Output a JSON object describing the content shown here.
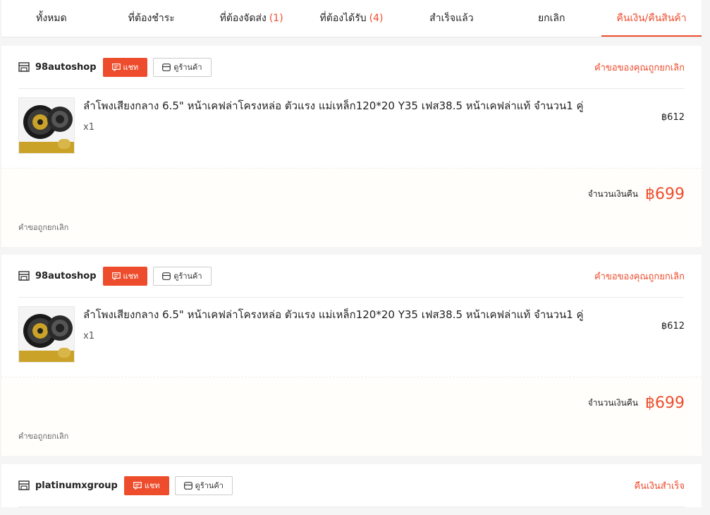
{
  "tabs": [
    {
      "label": "ทั้งหมด",
      "count": ""
    },
    {
      "label": "ที่ต้องชำระ",
      "count": ""
    },
    {
      "label": "ที่ต้องจัดส่ง",
      "count": "(1)"
    },
    {
      "label": "ที่ต้องได้รับ",
      "count": "(4)"
    },
    {
      "label": "สำเร็จแล้ว",
      "count": ""
    },
    {
      "label": "ยกเลิก",
      "count": ""
    },
    {
      "label": "คืนเงิน/คืนสินค้า",
      "count": ""
    }
  ],
  "active_tab": "คืนเงิน/คืนสินค้า",
  "accent_color": "#ee4d2d",
  "orders": [
    {
      "shop_name": "98autoshop",
      "chat_label": "แชท",
      "view_shop_label": "ดูร้านค้า",
      "status": "คำขอของคุณถูกยกเลิก",
      "product_title": "ลำโพงเสียงกลาง 6.5\" หน้าเคฟล่าโครงหล่อ ตัวแรง แม่เหล็ก120*20 Y35 เฟส38.5 หน้าเคฟล่าแท้ จำนวน1 คู่",
      "quantity": "x1",
      "price": "฿612",
      "image_label": "ลำโพงกลาง 6.5",
      "refund_label": "จำนวนเงินคืน",
      "refund_amount": "฿699",
      "note": "คำขอถูกยกเลิก"
    },
    {
      "shop_name": "98autoshop",
      "chat_label": "แชท",
      "view_shop_label": "ดูร้านค้า",
      "status": "คำขอของคุณถูกยกเลิก",
      "product_title": "ลำโพงเสียงกลาง 6.5\" หน้าเคฟล่าโครงหล่อ ตัวแรง แม่เหล็ก120*20 Y35 เฟส38.5 หน้าเคฟล่าแท้ จำนวน1 คู่",
      "quantity": "x1",
      "price": "฿612",
      "image_label": "ลำโพงกลาง 6.5",
      "refund_label": "จำนวนเงินคืน",
      "refund_amount": "฿699",
      "note": "คำขอถูกยกเลิก"
    },
    {
      "shop_name": "platinumxgroup",
      "chat_label": "แชท",
      "view_shop_label": "ดูร้านค้า",
      "status": "คืนเงินสำเร็จ"
    }
  ]
}
